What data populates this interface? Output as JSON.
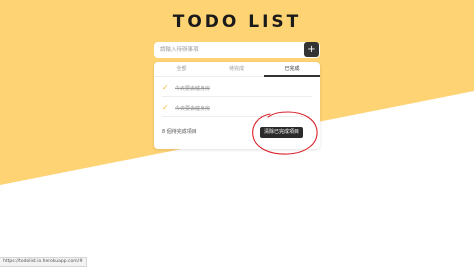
{
  "app": {
    "title": "TODO LIST"
  },
  "input": {
    "placeholder": "請輸入待辦事項",
    "value": ""
  },
  "add_button": {
    "label": "+"
  },
  "tabs": [
    {
      "label": "全部",
      "active": false
    },
    {
      "label": "待完成",
      "active": false
    },
    {
      "label": "已完成",
      "active": true
    }
  ],
  "todos": [
    {
      "text": "今天要去健身房",
      "done": true
    },
    {
      "text": "今天要去健身房",
      "done": true
    }
  ],
  "footer": {
    "count_text": "8 個待完成項目",
    "clear_label": "清除已完成項目"
  },
  "status_bar": {
    "url": "https://todolist.io.herokuapp.com/#"
  },
  "colors": {
    "accent_yellow": "#fdd373",
    "check_yellow": "#f5b93c",
    "dark": "#333333",
    "annotation_red": "#d9222a"
  },
  "icons": {
    "add": "plus-icon",
    "check": "check-icon"
  }
}
